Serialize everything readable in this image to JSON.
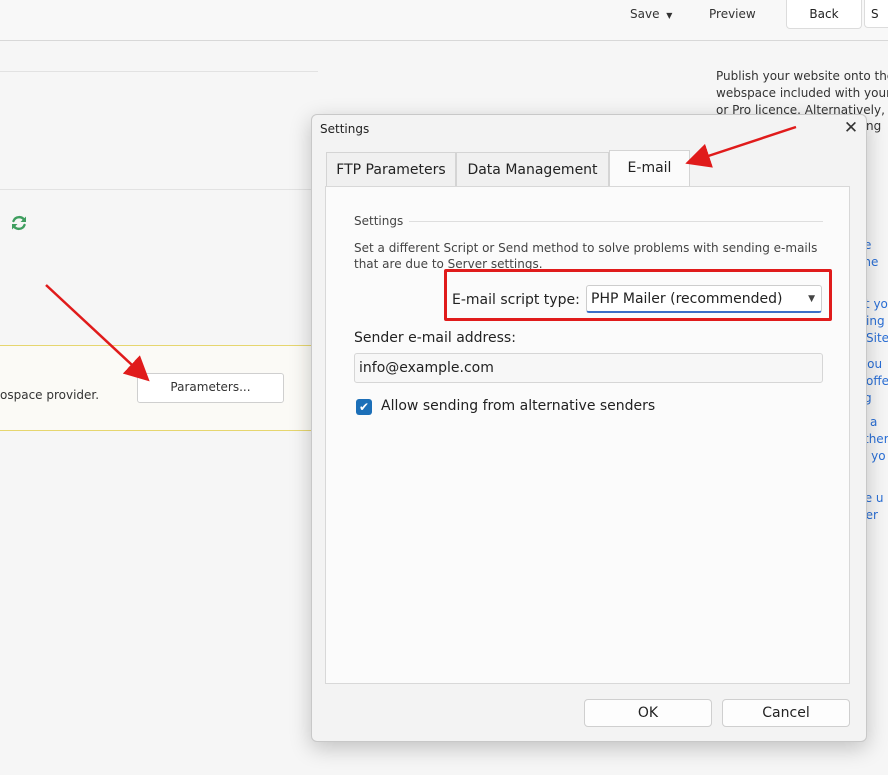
{
  "toolbar": {
    "save_label": "Save",
    "preview_label": "Preview",
    "back_label": "Back",
    "next_label_cut": "S"
  },
  "left": {
    "notice_text": "ospace provider.",
    "parameters_button": "Parameters..."
  },
  "right_text": "Publish your website onto the\nwebspace included with your\nor Pro licence. Alternatively,",
  "right_text_tail": "ng",
  "right_link_fragments": [
    "e",
    "d he",
    "rt yo",
    "ing",
    "Site",
    "you",
    "offe",
    "g",
    "a",
    "ther",
    "o yo",
    "te u",
    "der"
  ],
  "dialog": {
    "title": "Settings",
    "tabs": [
      "FTP Parameters",
      "Data Management",
      "E-mail"
    ],
    "active_tab": "E-mail",
    "group_label": "Settings",
    "description": "Set a different Script or Send method to solve problems with sending e-mails that are due to Server settings.",
    "script_type_label": "E-mail script type:",
    "script_type_value": "PHP Mailer (recommended)",
    "sender_label": "Sender e-mail address:",
    "sender_value": "info@example.com",
    "allow_label": "Allow sending from alternative senders",
    "allow_checked": true,
    "ok_label": "OK",
    "cancel_label": "Cancel"
  },
  "colors": {
    "annotation_red": "#e01b1b",
    "accent_blue": "#1c6fb8",
    "link_blue": "#2a6fd6",
    "notice_border": "#e6d66f",
    "refresh_green": "#3f9e5f"
  }
}
